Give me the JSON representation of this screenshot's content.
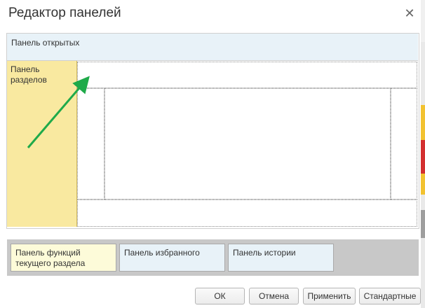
{
  "window": {
    "title": "Редактор панелей",
    "close_glyph": "✕"
  },
  "layout_panels": {
    "open": "Панель открытых",
    "sections": "Панель\nразделов"
  },
  "available_panels": [
    {
      "label": "Панель функций\nтекущего раздела",
      "color": "#fdfbd9"
    },
    {
      "label": "Панель избранного",
      "color": "#e8f2f8"
    },
    {
      "label": "Панель истории",
      "color": "#e8f2f8"
    }
  ],
  "buttons": {
    "ok": "ОК",
    "cancel": "Отмена",
    "apply": "Применить",
    "default": "Стандартные"
  },
  "colors": {
    "arrow": "#1faa4a",
    "sections_panel": "#f9e9a0",
    "open_panel": "#e8f2f8",
    "available_bg": "#c8c8c8"
  }
}
